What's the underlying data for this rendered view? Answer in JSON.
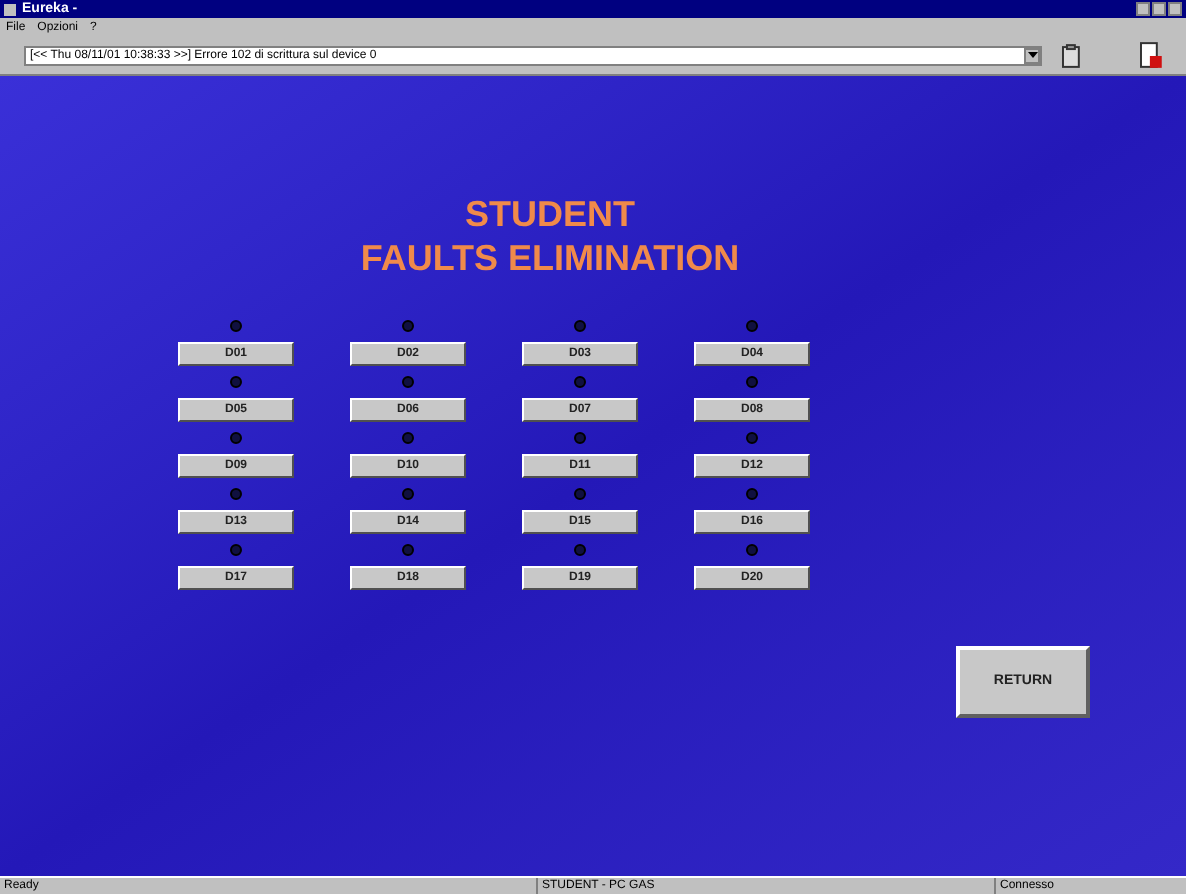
{
  "window": {
    "title": "Eureka -"
  },
  "menu": [
    "File",
    "Opzioni",
    "?"
  ],
  "toolbar": {
    "log_value": "[<< Thu 08/11/01 10:38:33 >>] Errore 102 di scrittura sul device 0"
  },
  "heading": [
    "STUDENT",
    "FAULTS ELIMINATION"
  ],
  "devices": [
    {
      "label": "D01",
      "on": false
    },
    {
      "label": "D02",
      "on": false
    },
    {
      "label": "D03",
      "on": false
    },
    {
      "label": "D04",
      "on": false
    },
    {
      "label": "D05",
      "on": false
    },
    {
      "label": "D06",
      "on": false
    },
    {
      "label": "D07",
      "on": false
    },
    {
      "label": "D08",
      "on": false
    },
    {
      "label": "D09",
      "on": false
    },
    {
      "label": "D10",
      "on": false
    },
    {
      "label": "D11",
      "on": false
    },
    {
      "label": "D12",
      "on": false
    },
    {
      "label": "D13",
      "on": false
    },
    {
      "label": "D14",
      "on": false
    },
    {
      "label": "D15",
      "on": false
    },
    {
      "label": "D16",
      "on": false
    },
    {
      "label": "D17",
      "on": false
    },
    {
      "label": "D18",
      "on": false
    },
    {
      "label": "D19",
      "on": false
    },
    {
      "label": "D20",
      "on": false
    }
  ],
  "return_button": "RETURN",
  "status_bar": [
    "Ready",
    "STUDENT - PC GAS",
    "Connesso"
  ]
}
